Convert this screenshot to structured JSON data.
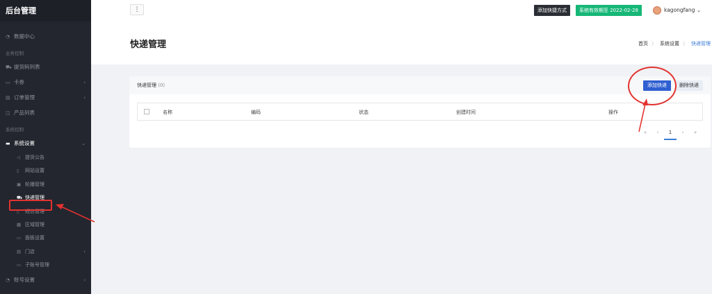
{
  "app": {
    "brand": "后台管理"
  },
  "header": {
    "menu_toggle_glyph": "⋮",
    "add_shortcut_label": "添加快捷方式",
    "validity_label": "系统有效期至 2022-02-28",
    "username": "kagongfang",
    "user_caret": "⌄"
  },
  "sidebar": {
    "dashboard": "数据中心",
    "group_business": "业务控制",
    "group_system": "系统控制",
    "items_business": [
      {
        "label": "提货码列表",
        "icon": "cart-icon",
        "has_arrow": false
      },
      {
        "label": "卡券",
        "icon": "card-icon",
        "has_arrow": true
      },
      {
        "label": "订单管理",
        "icon": "order-icon",
        "has_arrow": true
      },
      {
        "label": "产品列表",
        "icon": "product-icon",
        "has_arrow": false
      }
    ],
    "system_settings": "系统设置",
    "system_sub": [
      {
        "label": "提货公告",
        "icon": "notice-icon"
      },
      {
        "label": "网站设置",
        "icon": "site-icon"
      },
      {
        "label": "轮播管理",
        "icon": "carousel-icon"
      },
      {
        "label": "快递管理",
        "icon": "delivery-icon"
      },
      {
        "label": "短信管理",
        "icon": "sms-icon"
      },
      {
        "label": "区域管理",
        "icon": "region-icon"
      },
      {
        "label": "面板设置",
        "icon": "panel-icon"
      },
      {
        "label": "门店",
        "icon": "store-icon"
      },
      {
        "label": "子账号管理",
        "icon": "subaccount-icon"
      }
    ],
    "account_settings": "账号设置"
  },
  "page": {
    "title": "快递管理",
    "breadcrumb": [
      "首页",
      "系统设置",
      "快递管理"
    ]
  },
  "card": {
    "title": "快递管理",
    "count": "(0)",
    "add_button": "添加快递",
    "delete_button": "删除快递",
    "columns": [
      "名称",
      "编码",
      "状态",
      "创建时间",
      "操作"
    ]
  },
  "pagination": {
    "first": "«",
    "prev": "‹",
    "current": "1",
    "next": "›",
    "last": "»"
  },
  "colors": {
    "sidebar_bg": "#23262e",
    "accent_blue": "#2f5fd1",
    "green": "#16b777",
    "annotation_red": "#e3322f"
  }
}
